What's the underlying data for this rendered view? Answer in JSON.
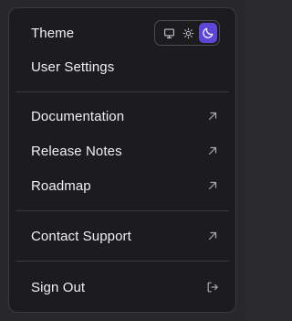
{
  "menu": {
    "theme_label": "Theme",
    "theme_options": [
      {
        "icon": "monitor-icon",
        "label": "System"
      },
      {
        "icon": "sun-icon",
        "label": "Light"
      },
      {
        "icon": "moon-icon",
        "label": "Dark",
        "selected": true
      }
    ],
    "user_settings_label": "User Settings",
    "documentation_label": "Documentation",
    "release_notes_label": "Release Notes",
    "roadmap_label": "Roadmap",
    "contact_support_label": "Contact Support",
    "sign_out_label": "Sign Out"
  },
  "icons": {
    "external": "arrow-up-right-icon",
    "sign_out": "log-out-icon"
  },
  "colors": {
    "menu_background": "#1c1c1f",
    "menu_border": "#3a3a3f",
    "text": "#f0f0f3",
    "muted_icon": "#a8a8b0",
    "accent": "#5b46d6"
  }
}
